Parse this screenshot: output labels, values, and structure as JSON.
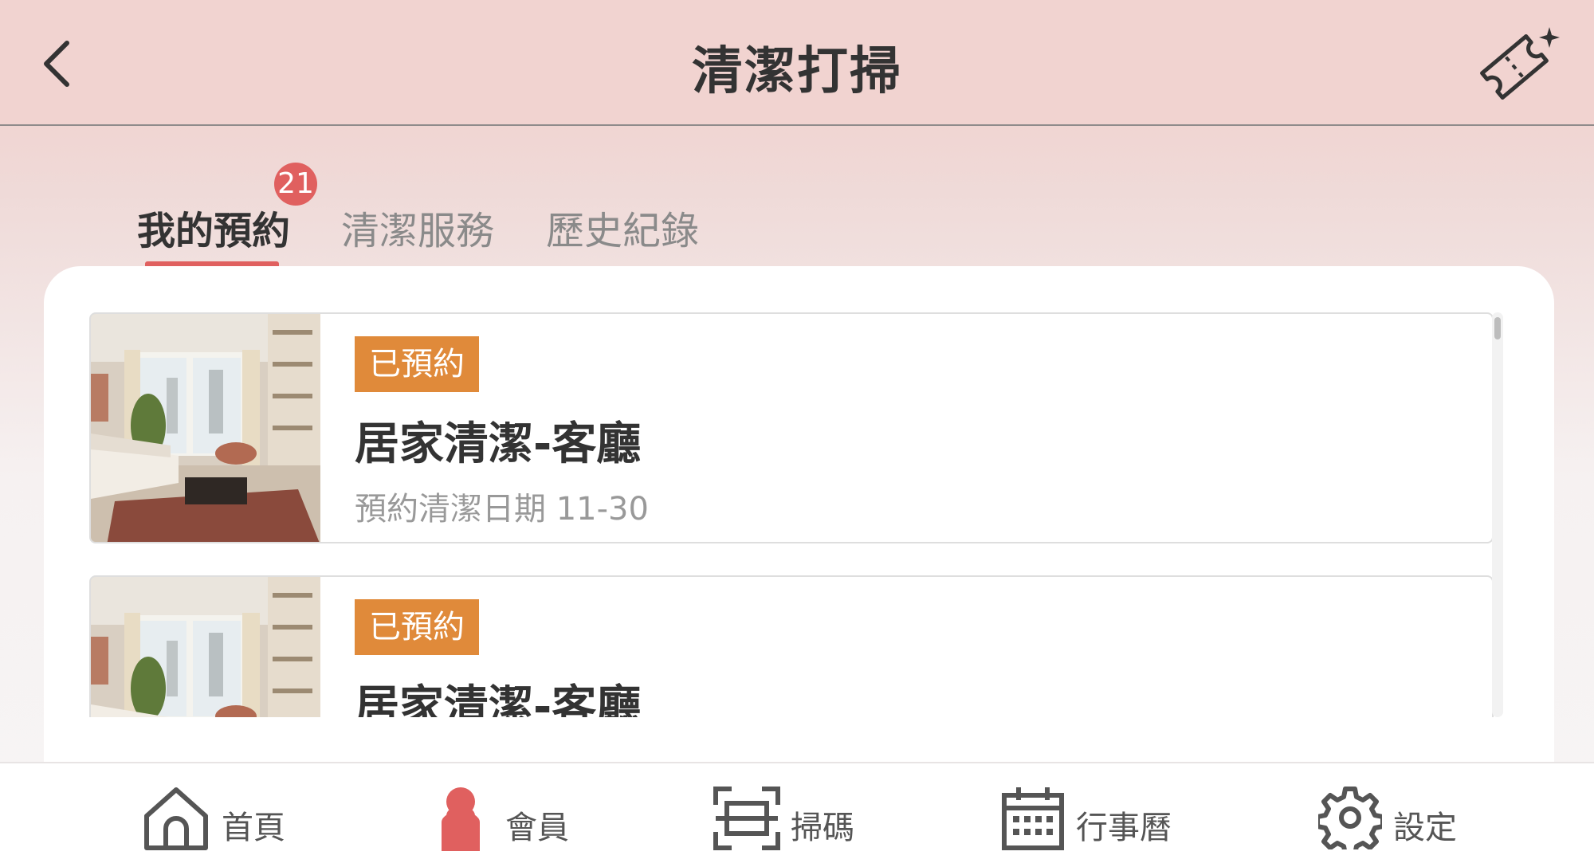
{
  "header": {
    "title": "清潔打掃",
    "back_icon": "chevron-left-icon",
    "ticket_icon": "ticket-sparkle-icon"
  },
  "tabs": [
    {
      "label": "我的預約",
      "active": true,
      "badge": "21"
    },
    {
      "label": "清潔服務",
      "active": false
    },
    {
      "label": "歷史紀錄",
      "active": false
    }
  ],
  "bookings": [
    {
      "status": "已預約",
      "title": "居家清潔-客廳",
      "date": "預約清潔日期 11-30"
    },
    {
      "status": "已預約",
      "title": "居家清潔-客廳"
    }
  ],
  "bottom_nav": [
    {
      "label": "首頁",
      "icon": "home-icon"
    },
    {
      "label": "會員",
      "icon": "member-icon",
      "active": true
    },
    {
      "label": "掃碼",
      "icon": "scan-icon"
    },
    {
      "label": "行事曆",
      "icon": "calendar-icon"
    },
    {
      "label": "設定",
      "icon": "gear-icon"
    }
  ],
  "colors": {
    "accent": "#e0605f",
    "status_badge": "#e08a3a",
    "header_bg": "#f1d3d0"
  }
}
